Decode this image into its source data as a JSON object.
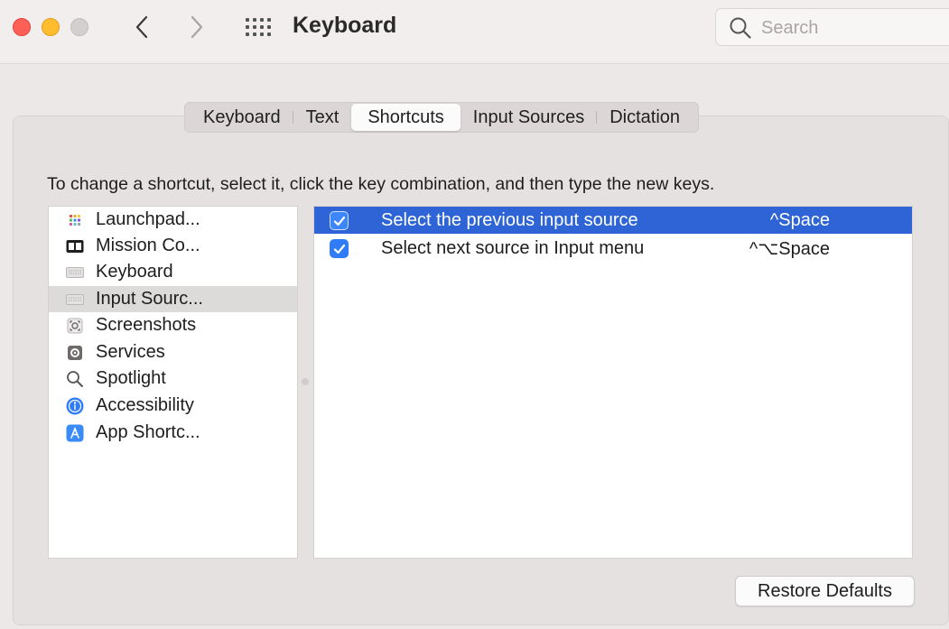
{
  "window": {
    "title": "Keyboard"
  },
  "search": {
    "placeholder": "Search"
  },
  "tabs": [
    {
      "label": "Keyboard"
    },
    {
      "label": "Text"
    },
    {
      "label": "Shortcuts",
      "active": true
    },
    {
      "label": "Input Sources"
    },
    {
      "label": "Dictation"
    }
  ],
  "instructions": "To change a shortcut, select it, click the key combination, and then type the new keys.",
  "categories": [
    {
      "label": "Launchpad...",
      "icon": "launchpad-icon"
    },
    {
      "label": "Mission Co...",
      "icon": "mission-control-icon"
    },
    {
      "label": "Keyboard",
      "icon": "keyboard-icon"
    },
    {
      "label": "Input Sourc...",
      "icon": "input-sources-icon",
      "selected": true
    },
    {
      "label": "Screenshots",
      "icon": "screenshots-icon"
    },
    {
      "label": "Services",
      "icon": "services-icon"
    },
    {
      "label": "Spotlight",
      "icon": "spotlight-icon"
    },
    {
      "label": "Accessibility",
      "icon": "accessibility-icon"
    },
    {
      "label": "App Shortc...",
      "icon": "app-shortcuts-icon"
    }
  ],
  "shortcuts": [
    {
      "label": "Select the previous input source",
      "keys": "^Space",
      "checked": true,
      "selected": true
    },
    {
      "label": "Select next source in Input menu",
      "keys": "^⌥Space",
      "checked": true,
      "selected": false
    }
  ],
  "buttons": {
    "restore_defaults": "Restore Defaults"
  },
  "colors": {
    "selection_blue": "#2e64d6",
    "checkbox_blue": "#2f7cf6",
    "close": "#fe5f57",
    "minimize": "#febc2e",
    "zoom": "#d3cfcf"
  }
}
